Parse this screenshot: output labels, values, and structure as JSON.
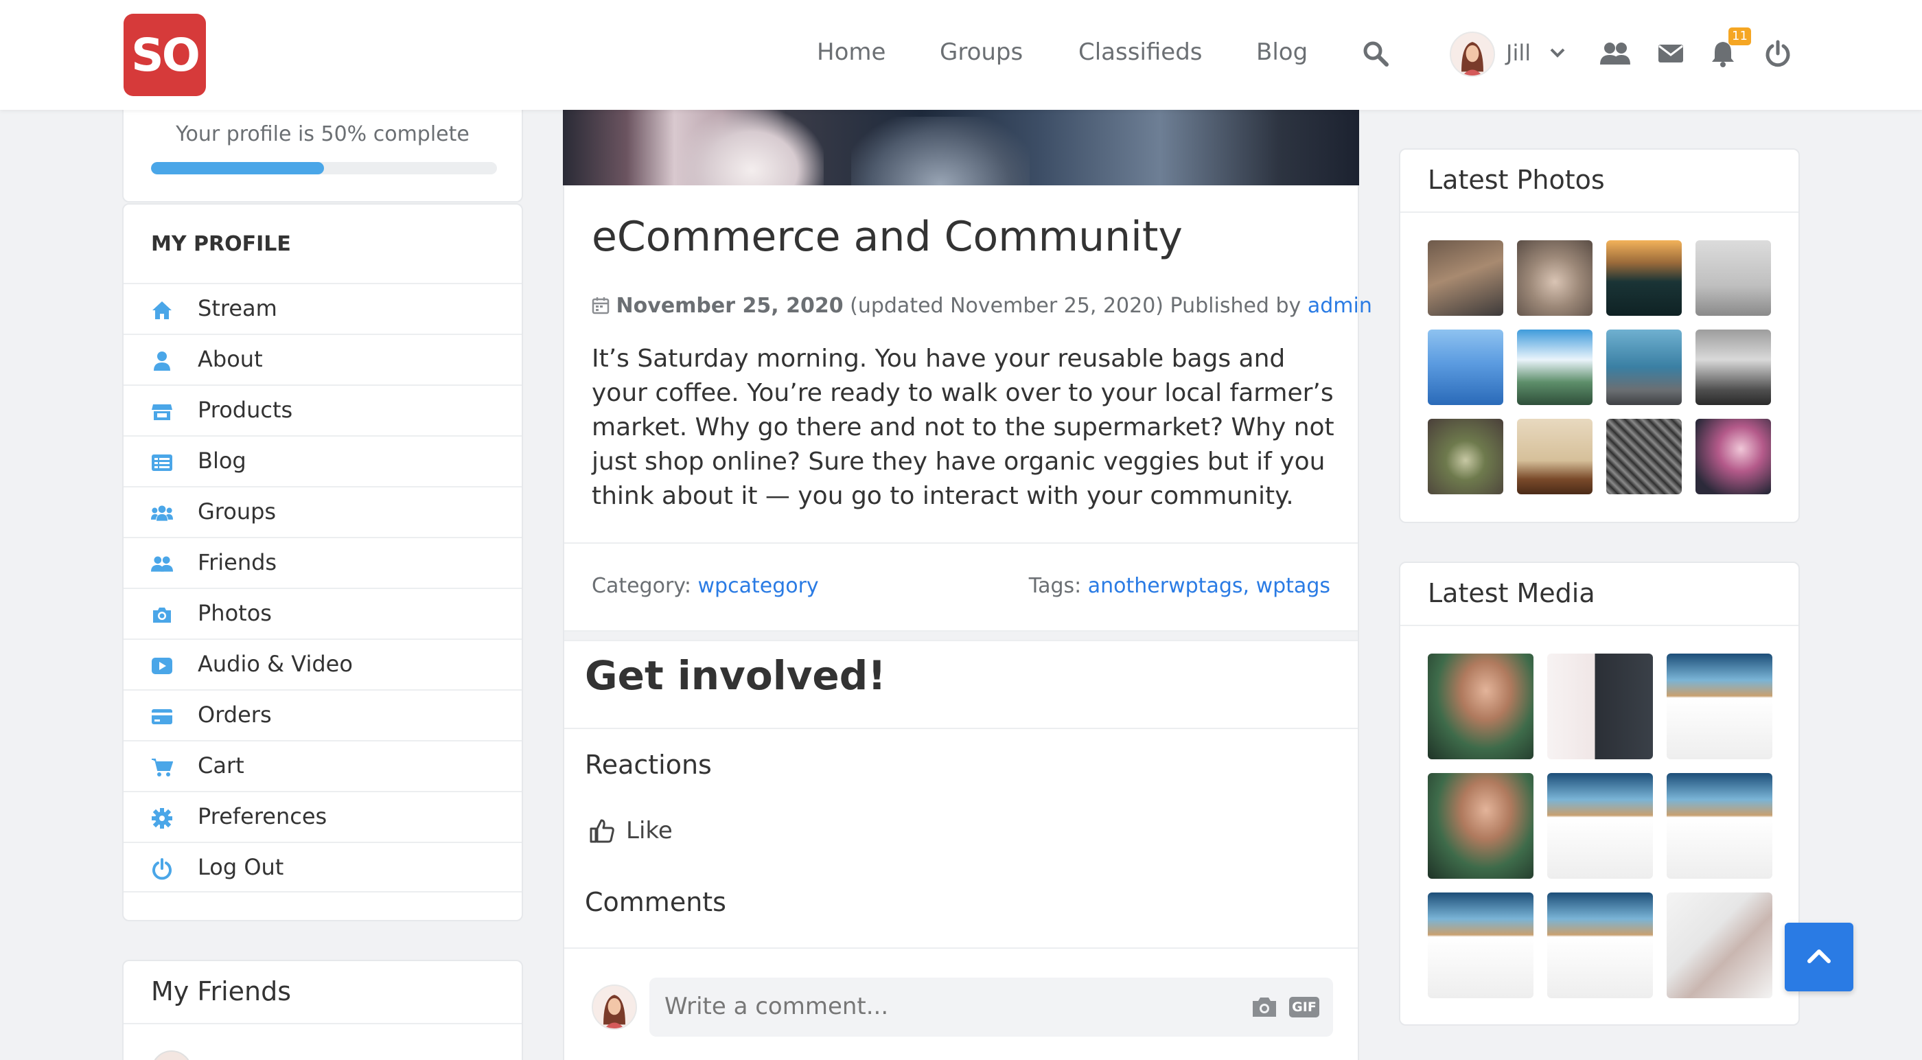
{
  "header": {
    "logo_text": "SO",
    "nav": [
      "Home",
      "Groups",
      "Classifieds",
      "Blog"
    ],
    "user_name": "Jill",
    "notification_count": "11"
  },
  "profile_progress": {
    "text": "Your profile is 50% complete",
    "percent": 50
  },
  "my_profile": {
    "title": "MY PROFILE",
    "items": [
      {
        "label": "Stream",
        "icon": "home-icon"
      },
      {
        "label": "About",
        "icon": "user-icon"
      },
      {
        "label": "Products",
        "icon": "store-icon"
      },
      {
        "label": "Blog",
        "icon": "blog-list-icon"
      },
      {
        "label": "Groups",
        "icon": "groups-icon"
      },
      {
        "label": "Friends",
        "icon": "friends-icon"
      },
      {
        "label": "Photos",
        "icon": "camera-icon"
      },
      {
        "label": "Audio & Video",
        "icon": "play-icon"
      },
      {
        "label": "Orders",
        "icon": "credit-card-icon"
      },
      {
        "label": "Cart",
        "icon": "cart-icon"
      },
      {
        "label": "Preferences",
        "icon": "gear-icon"
      },
      {
        "label": "Log Out",
        "icon": "power-icon"
      }
    ]
  },
  "my_friends": {
    "title": "My Friends"
  },
  "post": {
    "title": "eCommerce and Community",
    "date": "November 25, 2020",
    "updated": "(updated November 25, 2020) Published by",
    "author": "admin",
    "body": "It’s Saturday morning. You have your reusable bags and your coffee. You’re ready to walk over to your local farmer’s market. Why go there and not to the supermarket? Why not just shop online? Sure they have organic veggies but if you think about it — you go to interact with your community.",
    "category_label": "Category:",
    "category": "wpcategory",
    "tags_label": "Tags:",
    "tags": [
      "anotherwptags",
      "wptags"
    ],
    "tag_separator": ","
  },
  "engagement": {
    "heading": "Get involved!",
    "reactions_label": "Reactions",
    "like_label": "Like",
    "comments_label": "Comments",
    "comment_placeholder": "Write a comment...",
    "gif_label": "GIF"
  },
  "latest_photos": {
    "title": "Latest Photos"
  },
  "latest_media": {
    "title": "Latest Media"
  }
}
